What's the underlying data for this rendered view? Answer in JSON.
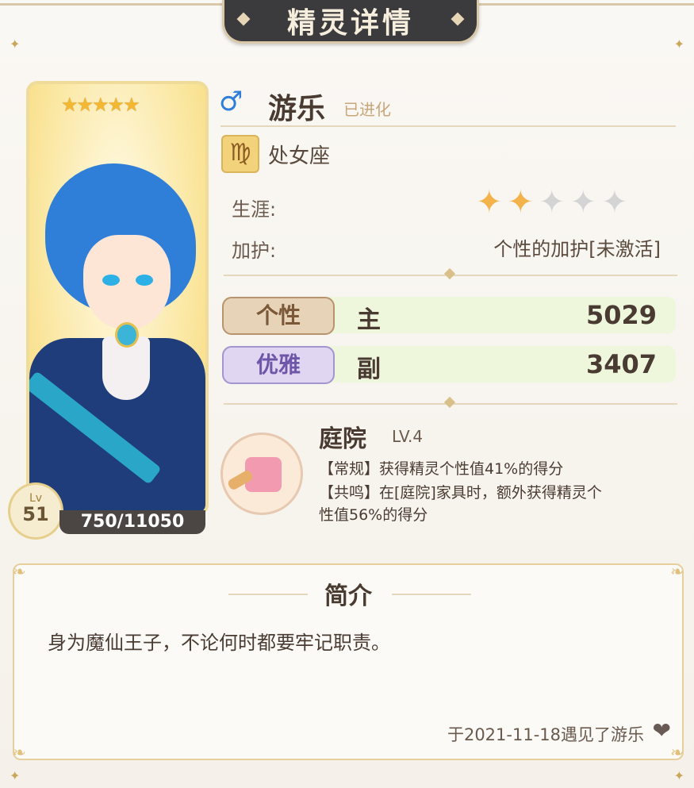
{
  "header": {
    "title": "精灵详情"
  },
  "card": {
    "rarity_stars": 5,
    "stars_text": "★★★★★",
    "level_label": "Lv",
    "level": "51",
    "exp": "750/11050"
  },
  "spirit": {
    "gender_symbol": "♂",
    "name": "游乐",
    "status": "已进化",
    "zodiac_symbol": "♍",
    "zodiac": "处女座"
  },
  "career": {
    "label": "生涯:",
    "stars_filled": 2,
    "stars_total": 5,
    "on_text": "✦✦",
    "off_text": "✦✦✦"
  },
  "blessing": {
    "label": "加护:",
    "value": "个性的加护[未激活]"
  },
  "stats": [
    {
      "attribute": "个性",
      "role": "主",
      "value": "5029"
    },
    {
      "attribute": "优雅",
      "role": "副",
      "value": "3407"
    }
  ],
  "furniture": {
    "name": "庭院",
    "level": "LV.4",
    "line1": "【常规】获得精灵个性值41%的得分",
    "line2": "【共鸣】在[庭院]家具时，额外获得精灵个",
    "line3": "性值56%的得分"
  },
  "intro": {
    "title": "简介",
    "text": "身为魔仙王子，不论何时都要牢记职责。",
    "met_text": "于2021-11-18遇见了游乐",
    "heart_icon": "❤"
  },
  "colors": {
    "accent_gold": "#d9c08a",
    "male_blue": "#2f7fd8",
    "stat_bg": "#eef6dc"
  }
}
